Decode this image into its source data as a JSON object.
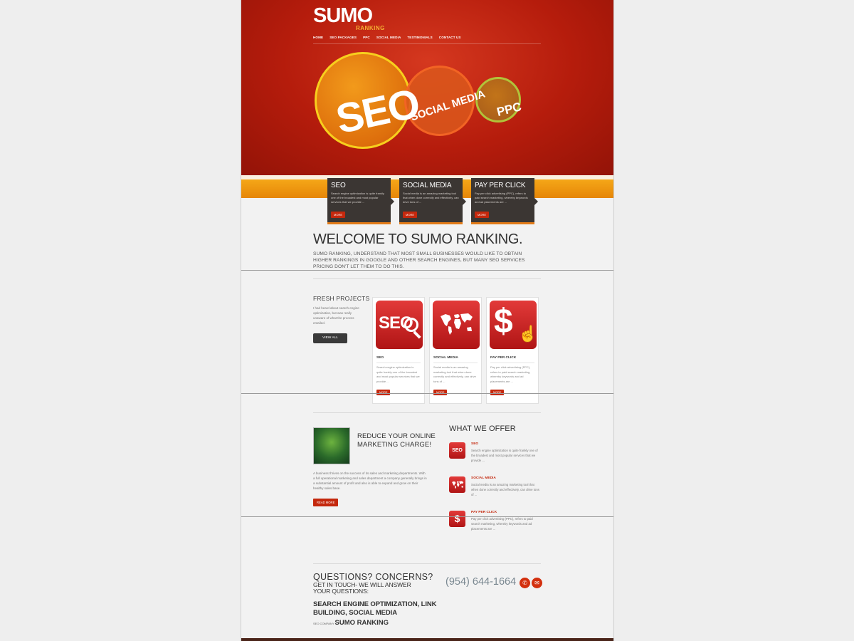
{
  "brand": {
    "logo_text": "SUMO",
    "logo_sub": "RANKING"
  },
  "nav": [
    "HOME",
    "SEO PACKAGES",
    "PPC",
    "SOCIAL MEDIA",
    "TESTIMONIALS",
    "CONTACT US"
  ],
  "hero": {
    "seo": "SEO",
    "social": "SOCIAL MEDIA",
    "ppc": "PPC"
  },
  "service_cards": [
    {
      "title": "SEO",
      "text": "Search engine optimization is quite frankly one of the broadest and most popular services that we provide ...",
      "more": "MORE"
    },
    {
      "title": "SOCIAL MEDIA",
      "text": "Social media is an amazing marketing tool that when done correctly and effectively, can drive tons of ...",
      "more": "MORE"
    },
    {
      "title": "PAY PER CLICK",
      "text": "Pay per click advertising (PPC), refers to paid search marketing, whereby keywords and ad placements are ...",
      "more": "MORE"
    }
  ],
  "welcome": {
    "title": "WELCOME TO SUMO RANKING.",
    "text": "SUMO RANKING, UNDERSTAND THAT MOST SMALL BUSINESSES WOULD LIKE TO OBTAIN HIGHER RANKINGS IN GOOGLE AND OTHER SEARCH ENGINES, BUT MANY SEO SERVICES PRICING DON'T LET THEM TO DO THIS."
  },
  "fresh": {
    "title": "FRESH PROJECTS",
    "text": "I had heard about search engine optimization, but was really unaware of what the process entailed.",
    "button": "VIEW ALL"
  },
  "projects": [
    {
      "icon_text": "SEO",
      "title": "SEO",
      "text": "Search engine optimization is quite frankly one of the broadest and most popular services that we provide ...",
      "more": "MORE"
    },
    {
      "title": "SOCIAL MEDIA",
      "text": "Social media is an amazing marketing tool that when done correctly and effectively, can drive tons of ...",
      "more": "MORE"
    },
    {
      "icon_text": "$",
      "title": "PAY PER CLICK",
      "text": "Pay per click advertising (PPC), refers to paid search marketing, whereby keywords and ad placements are ...",
      "more": "MORE"
    }
  ],
  "reduce": {
    "title": "REDUCE YOUR ONLINE MARKETING CHARGE!",
    "text": "A business thrives on the success of its sales and marketing departments. With a full operational marketing and sales department a company generally brings in a substantial amount of profit and also is able to expand and grow on their healthy sales base.",
    "button": "READ MORE"
  },
  "offer": {
    "title": "WHAT WE OFFER",
    "items": [
      {
        "icon_text": "SEO",
        "name": "SEO",
        "text": "Search engine optimization is quite frankly one of the broadest and most popular services that we provide ..."
      },
      {
        "name": "SOCIAL MEDIA",
        "text": "Social media is an amazing marketing tool that when done correctly and effectively, can drive tons of ..."
      },
      {
        "icon_text": "$",
        "name": "PAY PER CLICK",
        "text": "Pay per click advertising (PPC), refers to paid search marketing, whereby keywords and ad placements are ..."
      }
    ]
  },
  "contact": {
    "title": "QUESTIONS? CONCERNS?",
    "subtitle": "GET IN TOUCH- WE WILL ANSWER YOUR QUESTIONS:",
    "phone": "(954) 644-1664",
    "keywords": "SEARCH ENGINE OPTIMIZATION, LINK BUILDING, SOCIAL MEDIA",
    "company_label": "SEO COMPANY",
    "company_name": "SUMO RANKING"
  },
  "colors": {
    "red": "#c4280d",
    "orange": "#f5a718",
    "dark": "#3b3633"
  }
}
